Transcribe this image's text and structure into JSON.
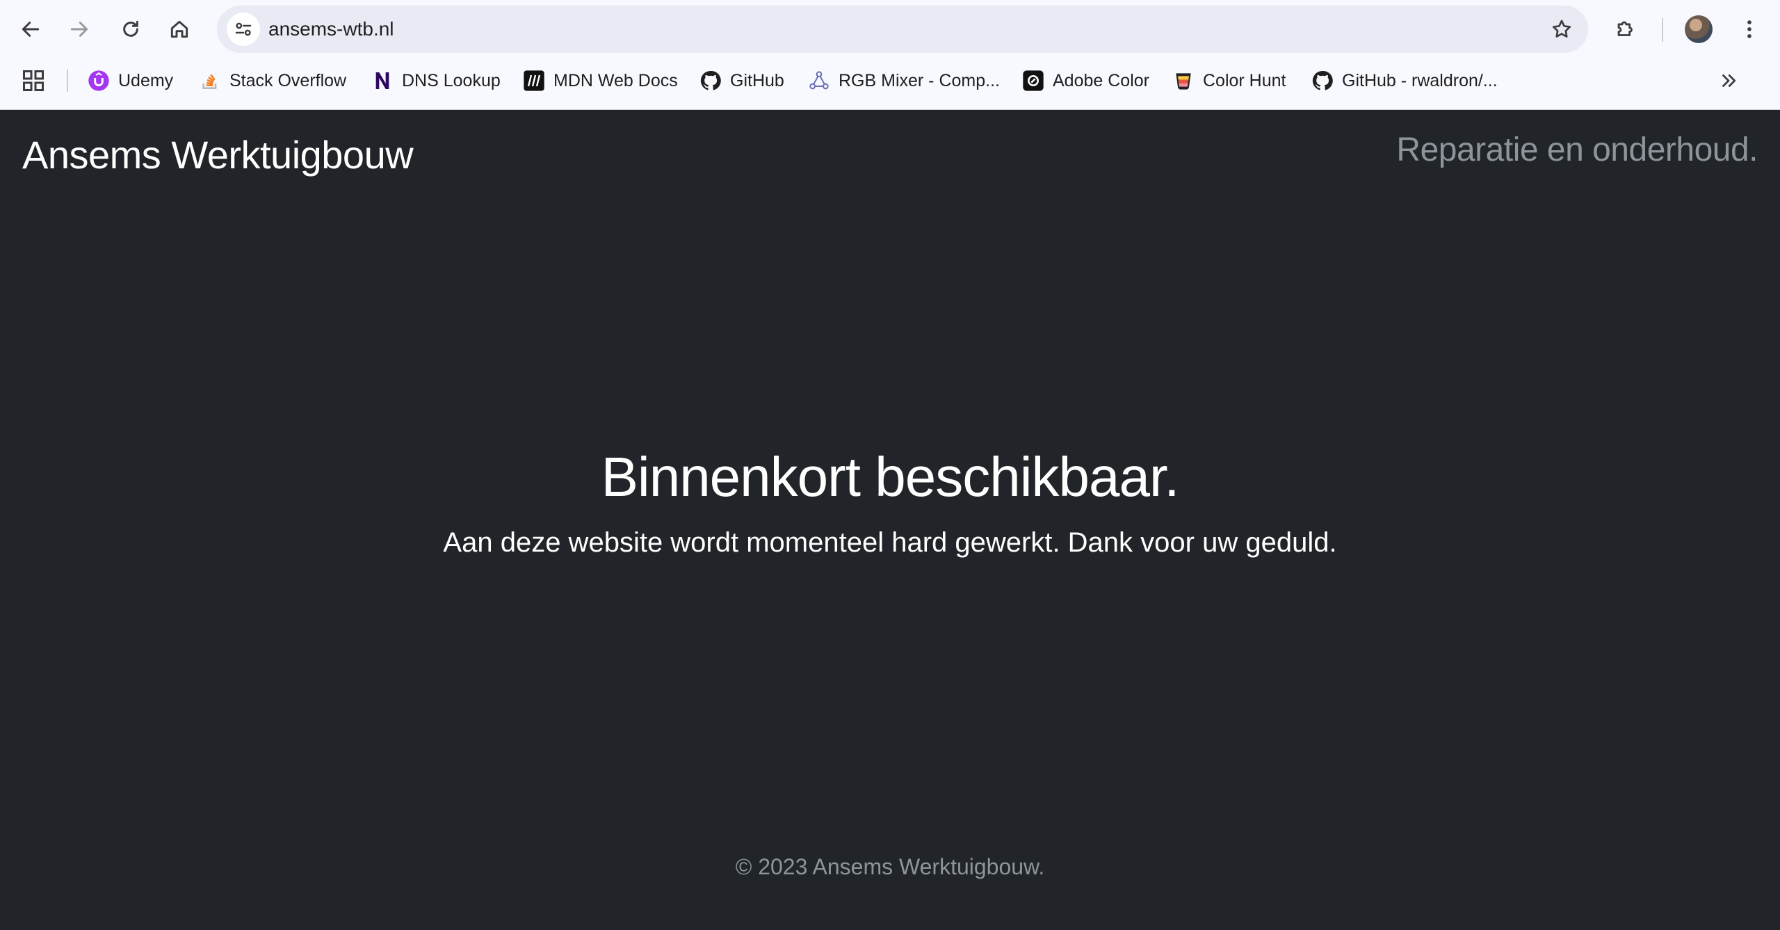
{
  "browser": {
    "url": "ansems-wtb.nl",
    "bookmarks": [
      {
        "label": "Udemy",
        "icon": "udemy-icon"
      },
      {
        "label": "Stack Overflow",
        "icon": "stackoverflow-icon"
      },
      {
        "label": "DNS Lookup",
        "icon": "dns-lookup-icon"
      },
      {
        "label": "MDN Web Docs",
        "icon": "mdn-icon"
      },
      {
        "label": "GitHub",
        "icon": "github-icon"
      },
      {
        "label": "RGB Mixer - Comp...",
        "icon": "rgb-mixer-icon"
      },
      {
        "label": "Adobe Color",
        "icon": "adobe-color-icon"
      },
      {
        "label": "Color Hunt",
        "icon": "color-hunt-icon"
      },
      {
        "label": "GitHub - rwaldron/...",
        "icon": "github-icon"
      }
    ]
  },
  "page": {
    "brand": "Ansems Werktuigbouw",
    "tagline": "Reparatie en onderhoud.",
    "hero_title": "Binnenkort beschikbaar.",
    "hero_subtitle": "Aan deze website wordt momenteel hard gewerkt. Dank voor uw geduld.",
    "footer": "© 2023 Ansems Werktuigbouw."
  },
  "colors": {
    "page_bg": "#212529",
    "muted_text": "#8f949a",
    "chrome_bg": "#f8f9fe",
    "omnibox_bg": "#e8eaf4"
  }
}
